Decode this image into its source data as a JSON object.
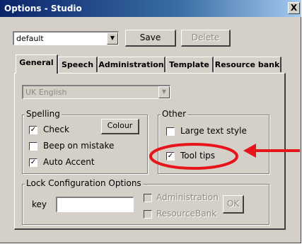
{
  "window": {
    "title": "Options - Studio",
    "close_glyph": "X"
  },
  "profile": {
    "selected": "default",
    "save_label": "Save",
    "delete_label": "Delete"
  },
  "tabs": [
    {
      "label": "General",
      "active": true
    },
    {
      "label": "Speech",
      "active": false
    },
    {
      "label": "Administration",
      "active": false
    },
    {
      "label": "Template",
      "active": false
    },
    {
      "label": "Resource bank",
      "active": false
    }
  ],
  "general": {
    "language": {
      "selected": "UK English",
      "enabled": false
    },
    "spelling": {
      "label": "Spelling",
      "check": {
        "label": "Check",
        "checked": true
      },
      "beep": {
        "label": "Beep on mistake",
        "checked": false
      },
      "auto_accent": {
        "label": "Auto Accent",
        "checked": true
      },
      "colour_label": "Colour"
    },
    "other": {
      "label": "Other",
      "large_text": {
        "label": "Large text style",
        "checked": false
      },
      "tool_tips": {
        "label": "Tool tips",
        "checked": true
      }
    },
    "lock": {
      "label": "Lock Configuration Options",
      "key_label": "key",
      "key_value": "",
      "administration": {
        "label": "Administration",
        "checked": false,
        "enabled": false
      },
      "resource_bank": {
        "label": "ResourceBank",
        "checked": false,
        "enabled": false
      },
      "ok_label": "OK"
    }
  },
  "annotation": {
    "highlight_color": "#e8141c",
    "target": "Tool tips"
  },
  "colors": {
    "dialog_bg": "#d4d0c8",
    "title_start": "#0a246a",
    "title_end": "#a6caf0"
  }
}
